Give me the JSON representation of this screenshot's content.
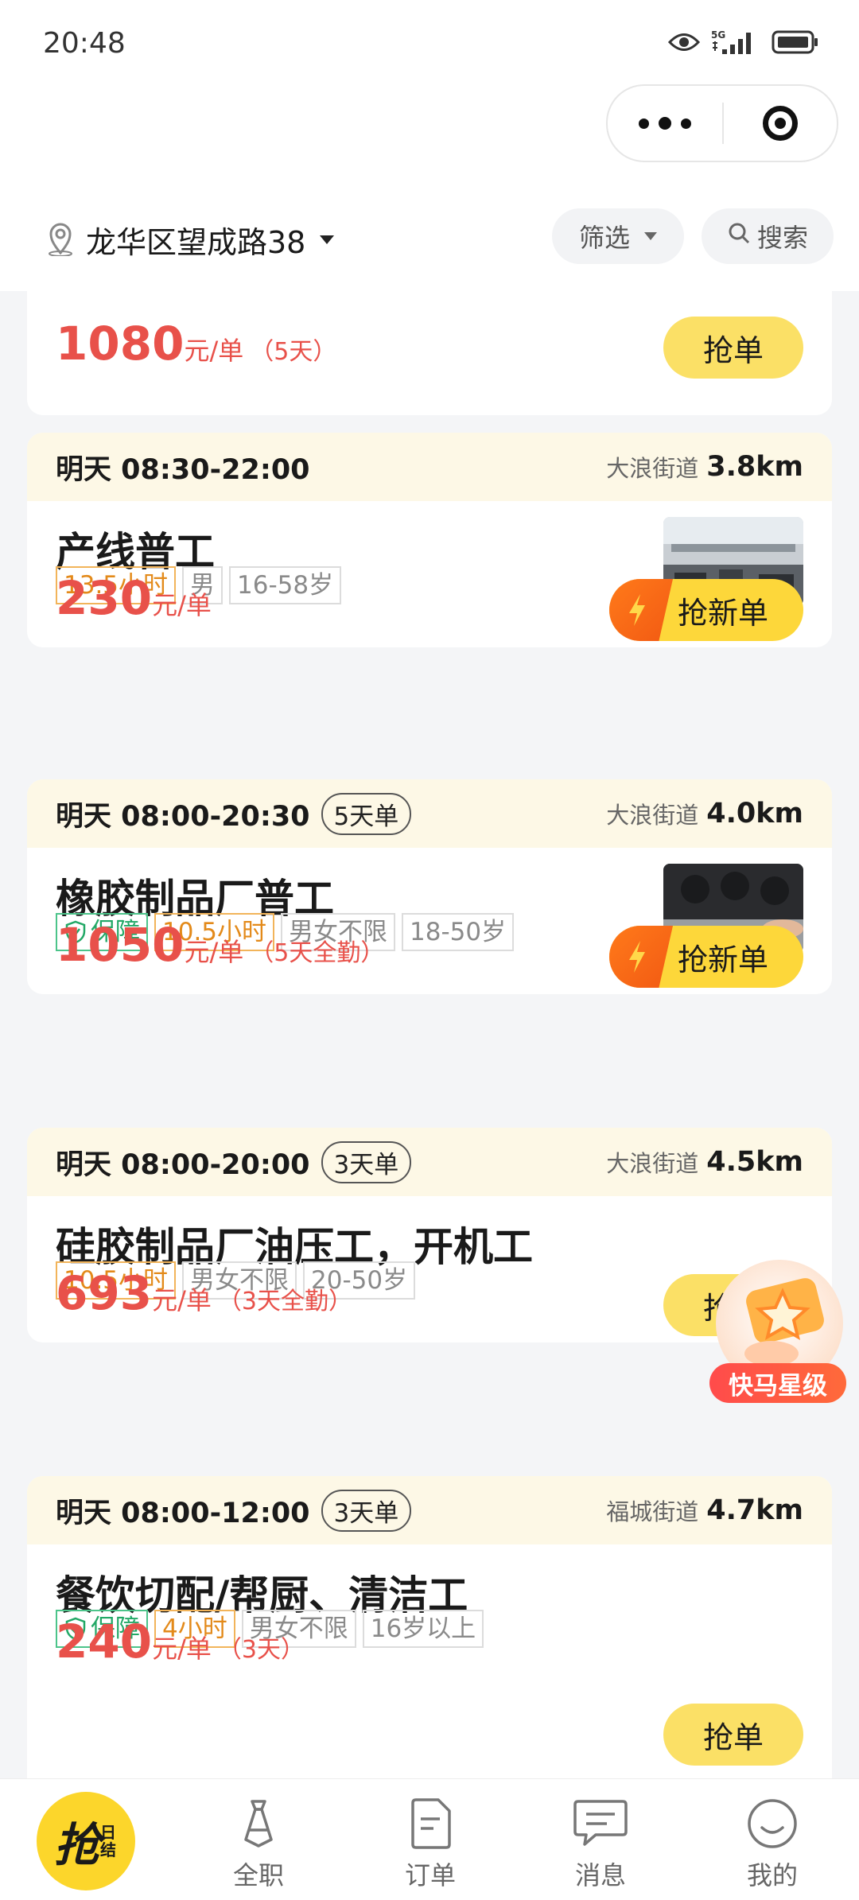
{
  "status_bar": {
    "time": "20:48",
    "network": "5G"
  },
  "location": {
    "address": "龙华区望成路38"
  },
  "toolbar": {
    "filter_label": "筛选",
    "search_label": "搜索"
  },
  "jobs": [
    {
      "price": "1080",
      "unit": "元/单",
      "note": "（5天）",
      "button": "抢单"
    },
    {
      "time": "明天 08:30-22:00",
      "street": "大浪街道",
      "distance": "3.8km",
      "title": "产线普工",
      "tags": [
        "13.5小时",
        "男",
        "16-58岁"
      ],
      "price": "230",
      "unit": "元/单",
      "note": "",
      "button": "抢新单"
    },
    {
      "time": "明天 08:00-20:30",
      "days": "5天单",
      "street": "大浪街道",
      "distance": "4.0km",
      "title": "橡胶制品厂普工",
      "tags": [
        "保障",
        "10.5小时",
        "男女不限",
        "18-50岁"
      ],
      "price": "1050",
      "unit": "元/单",
      "note": "（5天全勤）",
      "button": "抢新单"
    },
    {
      "time": "明天 08:00-20:00",
      "days": "3天单",
      "street": "大浪街道",
      "distance": "4.5km",
      "title": "硅胶制品厂油压工，开机工",
      "tags": [
        "10.5小时",
        "男女不限",
        "20-50岁"
      ],
      "price": "693",
      "unit": "元/单",
      "note": "（3天全勤）",
      "button": "抢单"
    },
    {
      "time": "明天 08:00-12:00",
      "days": "3天单",
      "street": "福城街道",
      "distance": "4.7km",
      "title": "餐饮切配/帮厨、清洁工",
      "tags": [
        "保障",
        "4小时",
        "男女不限",
        "16岁以上"
      ],
      "price": "240",
      "unit": "元/单",
      "note": "（3天）",
      "button": "抢单"
    }
  ],
  "float_badge": {
    "label": "快马星级"
  },
  "tabbar": {
    "home_big": "抢",
    "home_small": "日结",
    "items": [
      {
        "label": "全职",
        "icon": "tie-icon"
      },
      {
        "label": "订单",
        "icon": "order-doc-icon"
      },
      {
        "label": "消息",
        "icon": "message-icon"
      },
      {
        "label": "我的",
        "icon": "smile-icon"
      }
    ]
  },
  "colors": {
    "accent_yellow": "#fcd62b",
    "price_red": "#e8514a",
    "card_header": "#fdf8e6"
  }
}
